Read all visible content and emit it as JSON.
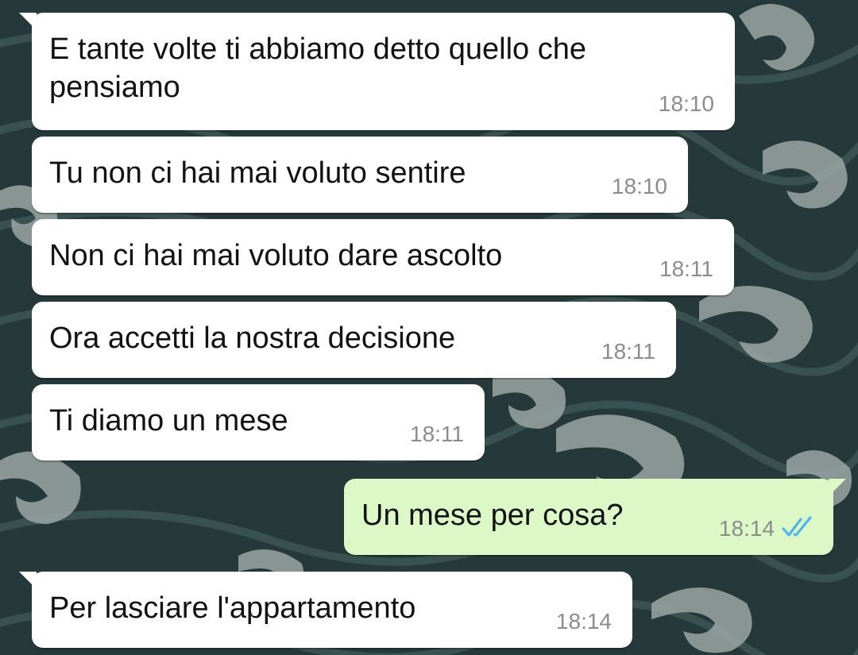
{
  "colors": {
    "incoming_bubble": "#ffffff",
    "outgoing_bubble": "#dcf8c6",
    "timestamp": "#8c8c8c",
    "read_ticks": "#4fb6ec",
    "wallpaper": "#26393a"
  },
  "messages": [
    {
      "direction": "incoming",
      "text": "E tante volte ti abbiamo detto quello che\npensiamo",
      "time": "18:10"
    },
    {
      "direction": "incoming",
      "text": "Tu non ci hai mai voluto sentire",
      "time": "18:10"
    },
    {
      "direction": "incoming",
      "text": "Non ci hai mai voluto dare ascolto",
      "time": "18:11"
    },
    {
      "direction": "incoming",
      "text": "Ora accetti la nostra decisione",
      "time": "18:11"
    },
    {
      "direction": "incoming",
      "text": "Ti diamo un mese",
      "time": "18:11"
    },
    {
      "direction": "outgoing",
      "text": "Un mese per cosa?",
      "time": "18:14",
      "status_icon": "double-check-read-icon"
    },
    {
      "direction": "incoming",
      "text": "Per lasciare l'appartamento",
      "time": "18:14"
    }
  ]
}
